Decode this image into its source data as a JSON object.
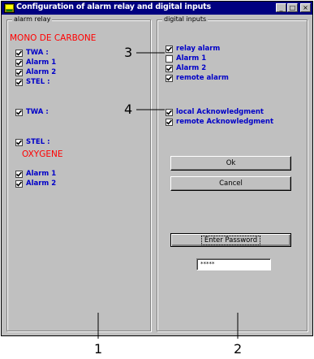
{
  "window": {
    "title": "Configuration of alarm relay and digital inputs",
    "controls": {
      "minimize": "_",
      "maximize": "□",
      "close": "×"
    }
  },
  "alarm_relay": {
    "label": "alarm relay",
    "group1": "MONO DE CARBONE",
    "group2": "OXYGENE",
    "checks": [
      {
        "label": "TWA :",
        "checked": true
      },
      {
        "label": "Alarm 1",
        "checked": true
      },
      {
        "label": "Alarm 2",
        "checked": true
      },
      {
        "label": "STEL :",
        "checked": true
      },
      {
        "label": "TWA :",
        "checked": true
      },
      {
        "label": "STEL :",
        "checked": true
      },
      {
        "label": "Alarm 1",
        "checked": true
      },
      {
        "label": "Alarm 2",
        "checked": true
      }
    ]
  },
  "digital_inputs": {
    "label": "digital inputs",
    "checks": [
      {
        "label": "relay alarm",
        "checked": true
      },
      {
        "label": "Alarm 1",
        "checked": false
      },
      {
        "label": "Alarm 2",
        "checked": true
      },
      {
        "label": "remote alarm",
        "checked": true
      },
      {
        "label": "local Acknowledgment",
        "checked": true
      },
      {
        "label": "remote Acknowledgment",
        "checked": true
      }
    ]
  },
  "buttons": {
    "ok": "Ok",
    "cancel": "Cancel",
    "enter_password": "Enter Password"
  },
  "password": {
    "value": "*****"
  },
  "callouts": {
    "c1": "1",
    "c2": "2",
    "c3": "3",
    "c4": "4"
  },
  "colors": {
    "title_bar": "#000080",
    "group_heading": "#ff0000",
    "check_label": "#0000c8",
    "window_face": "#c0c0c0"
  }
}
